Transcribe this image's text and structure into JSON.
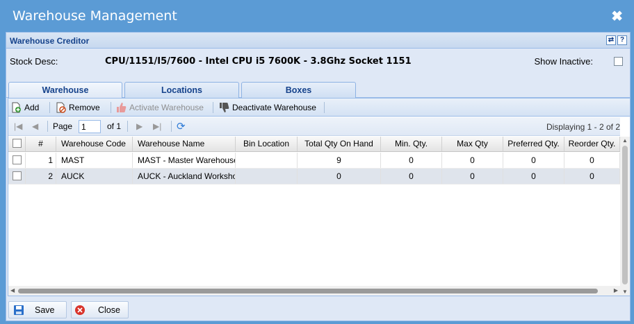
{
  "window": {
    "title": "Warehouse Management",
    "close_glyph": "✖"
  },
  "panel": {
    "title": "Warehouse Creditor",
    "tools": [
      "refresh-icon",
      "help-icon"
    ]
  },
  "stock": {
    "label": "Stock Desc:",
    "value": "CPU/1151/I5/7600 - Intel CPU i5 7600K - 3.8Ghz Socket 1151",
    "show_inactive_label": "Show Inactive:",
    "show_inactive_checked": false
  },
  "tabs": [
    {
      "label": "Warehouse",
      "active": true
    },
    {
      "label": "Locations",
      "active": false
    },
    {
      "label": "Boxes",
      "active": false
    }
  ],
  "toolbar": {
    "add": "Add",
    "remove": "Remove",
    "activate": "Activate Warehouse",
    "deactivate": "Deactivate Warehouse"
  },
  "pager": {
    "page_label": "Page",
    "page_value": "1",
    "of_label": "of 1",
    "displaying": "Displaying 1 - 2 of 2"
  },
  "columns": [
    "#",
    "Warehouse Code",
    "Warehouse Name",
    "Bin Location",
    "Total Qty On Hand",
    "Min. Qty.",
    "Max Qty",
    "Preferred Qty.",
    "Reorder Qty."
  ],
  "rows": [
    {
      "num": "1",
      "code": "MAST",
      "name": "MAST - Master Warehouse",
      "bin": "",
      "total": "9",
      "min": "0",
      "max": "0",
      "pref": "0",
      "reorder": "0"
    },
    {
      "num": "2",
      "code": "AUCK",
      "name": "AUCK - Auckland Workshop",
      "bin": "",
      "total": "0",
      "min": "0",
      "max": "0",
      "pref": "0",
      "reorder": "0"
    }
  ],
  "footer": {
    "save": "Save",
    "close": "Close"
  },
  "colors": {
    "title_bar": "#5b9bd5",
    "panel_title": "#15428b",
    "close_red": "#d9342b",
    "save_blue": "#2a6fc9"
  }
}
